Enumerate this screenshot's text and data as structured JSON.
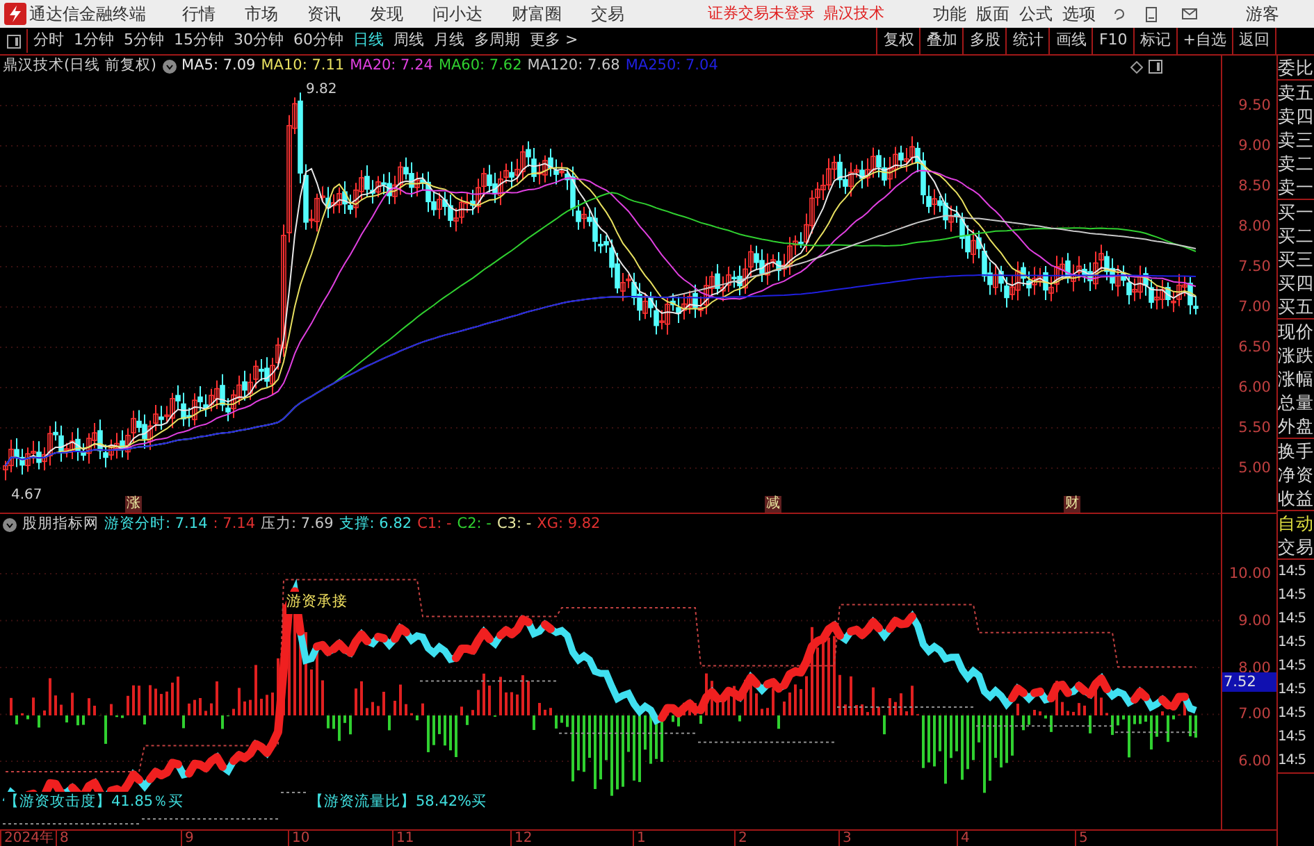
{
  "app": {
    "title": "通达信金融终端",
    "menus": [
      "行情",
      "市场",
      "资讯",
      "发现",
      "问小达",
      "财富圈",
      "交易"
    ],
    "status": "证券交易未登录",
    "stock_link": "鼎汉技术",
    "right_menus": [
      "功能",
      "版面",
      "公式",
      "选项"
    ],
    "user": "游客"
  },
  "period_tabs": [
    {
      "label": "分时",
      "selected": false
    },
    {
      "label": "1分钟",
      "selected": false
    },
    {
      "label": "5分钟",
      "selected": false
    },
    {
      "label": "15分钟",
      "selected": false
    },
    {
      "label": "30分钟",
      "selected": false
    },
    {
      "label": "60分钟",
      "selected": false
    },
    {
      "label": "日线",
      "selected": true
    },
    {
      "label": "周线",
      "selected": false
    },
    {
      "label": "月线",
      "selected": false
    },
    {
      "label": "多周期",
      "selected": false
    },
    {
      "label": "更多 >",
      "selected": false
    }
  ],
  "toolbar_buttons": [
    "复权",
    "叠加",
    "多股",
    "统计",
    "画线",
    "F10",
    "标记",
    "+自选",
    "返回"
  ],
  "main_chart": {
    "title": "鼎汉技术(日线 前复权)",
    "ma_legend": [
      {
        "text": "MA5: 7.09",
        "color": "#e8e8e8"
      },
      {
        "text": "MA10: 7.11",
        "color": "#e8e060"
      },
      {
        "text": "MA20: 7.24",
        "color": "#e040e0"
      },
      {
        "text": "MA60: 7.62",
        "color": "#30d030"
      },
      {
        "text": "MA120: 7.68",
        "color": "#c8c8c8"
      },
      {
        "text": "MA250: 7.04",
        "color": "#2020e0"
      }
    ],
    "y_ticks": [
      "9.50",
      "9.00",
      "8.50",
      "8.00",
      "7.50",
      "7.00",
      "6.50",
      "6.00",
      "5.50",
      "5.00"
    ],
    "high_marker": "9.82",
    "low_marker": "4.67",
    "events": [
      "涨",
      "减",
      "财"
    ]
  },
  "indicator_chart": {
    "title": "股朋指标网",
    "legend": [
      {
        "text": "游资分时: 7.14",
        "color": "#40e0e0"
      },
      {
        "text": ": 7.14",
        "color": "#e03030"
      },
      {
        "text": "压力: 7.69",
        "color": "#c8c8c8"
      },
      {
        "text": "支撑: 6.82",
        "color": "#40e0e0"
      },
      {
        "text": "C1: -",
        "color": "#e03030"
      },
      {
        "text": "C2: -",
        "color": "#30d030"
      },
      {
        "text": "C3: -",
        "color": "#e8e8a0"
      },
      {
        "text": "XG: 9.82",
        "color": "#e03030"
      }
    ],
    "y_ticks": [
      "10.00",
      "9.00",
      "8.00",
      "7.00",
      "6.00"
    ],
    "price_tag": "7.52",
    "label_support": "游资承接",
    "label_attack": "【游资攻击度】41.85％买",
    "label_flow": "【游资流量比】58.42%买"
  },
  "date_axis": [
    "2024年",
    "8",
    "9",
    "10",
    "11",
    "12",
    "1",
    "2",
    "3",
    "4",
    "5"
  ],
  "side_panel": [
    [
      {
        "label": "委比",
        "kind": "label"
      }
    ],
    [
      {
        "label": "卖五",
        "kind": "label"
      },
      {
        "label": "卖四",
        "kind": "label"
      },
      {
        "label": "卖三",
        "kind": "label"
      },
      {
        "label": "卖二",
        "kind": "label"
      },
      {
        "label": "卖一",
        "kind": "label"
      }
    ],
    [
      {
        "label": "买一",
        "kind": "label"
      },
      {
        "label": "买二",
        "kind": "label"
      },
      {
        "label": "买三",
        "kind": "label"
      },
      {
        "label": "买四",
        "kind": "label"
      },
      {
        "label": "买五",
        "kind": "label"
      }
    ],
    [
      {
        "label": "现价",
        "kind": "label"
      },
      {
        "label": "涨跌",
        "kind": "label"
      },
      {
        "label": "涨幅",
        "kind": "label"
      },
      {
        "label": "总量",
        "kind": "label"
      },
      {
        "label": "外盘",
        "kind": "label"
      }
    ],
    [
      {
        "label": "换手",
        "kind": "label"
      },
      {
        "label": "净资",
        "kind": "label"
      },
      {
        "label": "收益",
        "kind": "label"
      }
    ],
    [
      {
        "label": "自动",
        "kind": "mode"
      },
      {
        "label": "交易",
        "kind": "label"
      }
    ],
    [
      {
        "label": "14:5",
        "kind": "label"
      },
      {
        "label": "14:5",
        "kind": "label"
      },
      {
        "label": "14:5",
        "kind": "label"
      },
      {
        "label": "14:5",
        "kind": "label"
      },
      {
        "label": "14:5",
        "kind": "label"
      },
      {
        "label": "14:5",
        "kind": "label"
      },
      {
        "label": "14:5",
        "kind": "label"
      },
      {
        "label": "14:5",
        "kind": "label"
      },
      {
        "label": "14:5",
        "kind": "label"
      }
    ]
  ]
}
